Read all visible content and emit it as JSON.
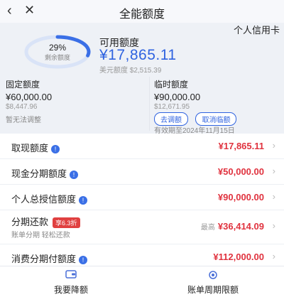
{
  "header": {
    "back_icon": "‹",
    "close_icon": "✕",
    "title": "全能额度"
  },
  "card_tab": "个人信用卡",
  "summary": {
    "percent_text": "29%",
    "percent_value": 0.29,
    "percent_label": "剩余额度",
    "available_label": "可用额度",
    "available_amount": "¥17,865.11",
    "usd_label": "美元额度",
    "usd_amount": "$2,515.39"
  },
  "fixed": {
    "label": "固定额度",
    "amount": "¥60,000.00",
    "usd": "$8,447.96",
    "hint": "暂无法调整"
  },
  "temp": {
    "label": "临时额度",
    "amount": "¥90,000.00",
    "usd": "$12,671.95",
    "btn_adjust": "去调额",
    "btn_cancel": "取消临额",
    "valid": "有效期至2024年11月15日"
  },
  "rows": [
    {
      "name": "取现额度",
      "value": "¥17,865.11"
    },
    {
      "name": "现金分期额度",
      "value": "¥50,000.00"
    },
    {
      "name": "个人总授信额度",
      "value": "¥90,000.00"
    },
    {
      "name": "分期还款",
      "badge": "享6.3折",
      "sub": "账单分期 轻松还款",
      "prefix": "最高",
      "value": "¥36,414.09"
    },
    {
      "name": "消费分期付额度",
      "value": "¥112,000.00"
    }
  ],
  "bottom": {
    "left_label": "我要降额",
    "right_label": "账单周期限额"
  },
  "colors": {
    "accent": "#2f63e0",
    "amount_red": "#e0323e"
  }
}
